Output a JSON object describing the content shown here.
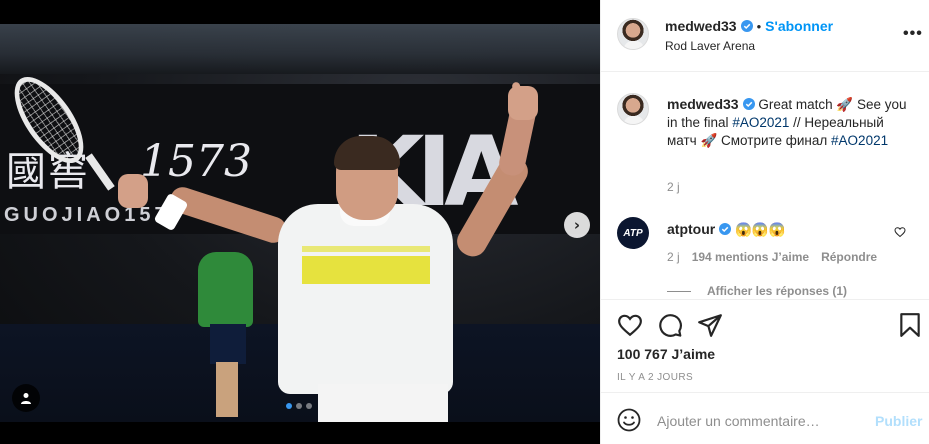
{
  "post": {
    "username": "medwed33",
    "follow_separator": "•",
    "follow_label": "S'abonner",
    "location": "Rod Laver Arena",
    "more_label": "•••"
  },
  "media": {
    "sponsor_cn": "國窖",
    "sponsor_number": "1573",
    "sponsor_latin": "GUOJIAO1573",
    "sponsor_kia": "KIA",
    "next_arrow": "›",
    "carousel_total": 3,
    "carousel_active_index": 0
  },
  "caption": {
    "username": "medwed33",
    "text_1": "Great match 🚀 See you in the final",
    "hashtag_1": "#AO2021",
    "text_2": "// Нереальный матч 🚀 Смотрите финал",
    "hashtag_2": "#AO2021",
    "time": "2 j"
  },
  "comment": {
    "username": "atptour",
    "avatar_text": "ATP",
    "text": "😱😱😱",
    "time": "2 j",
    "likes": "194 mentions J’aime",
    "reply_label": "Répondre",
    "view_replies": "Afficher les réponses (1)"
  },
  "actions": {
    "likes": "100 767 J’aime",
    "ago": "IL Y A 2 JOURS"
  },
  "add_comment": {
    "placeholder": "Ajouter un commentaire…",
    "publish_label": "Publier"
  },
  "colors": {
    "accent": "#0095f6",
    "hashtag": "#00376b",
    "muted": "#8e8e8e",
    "publish_disabled": "#b2dffc"
  }
}
